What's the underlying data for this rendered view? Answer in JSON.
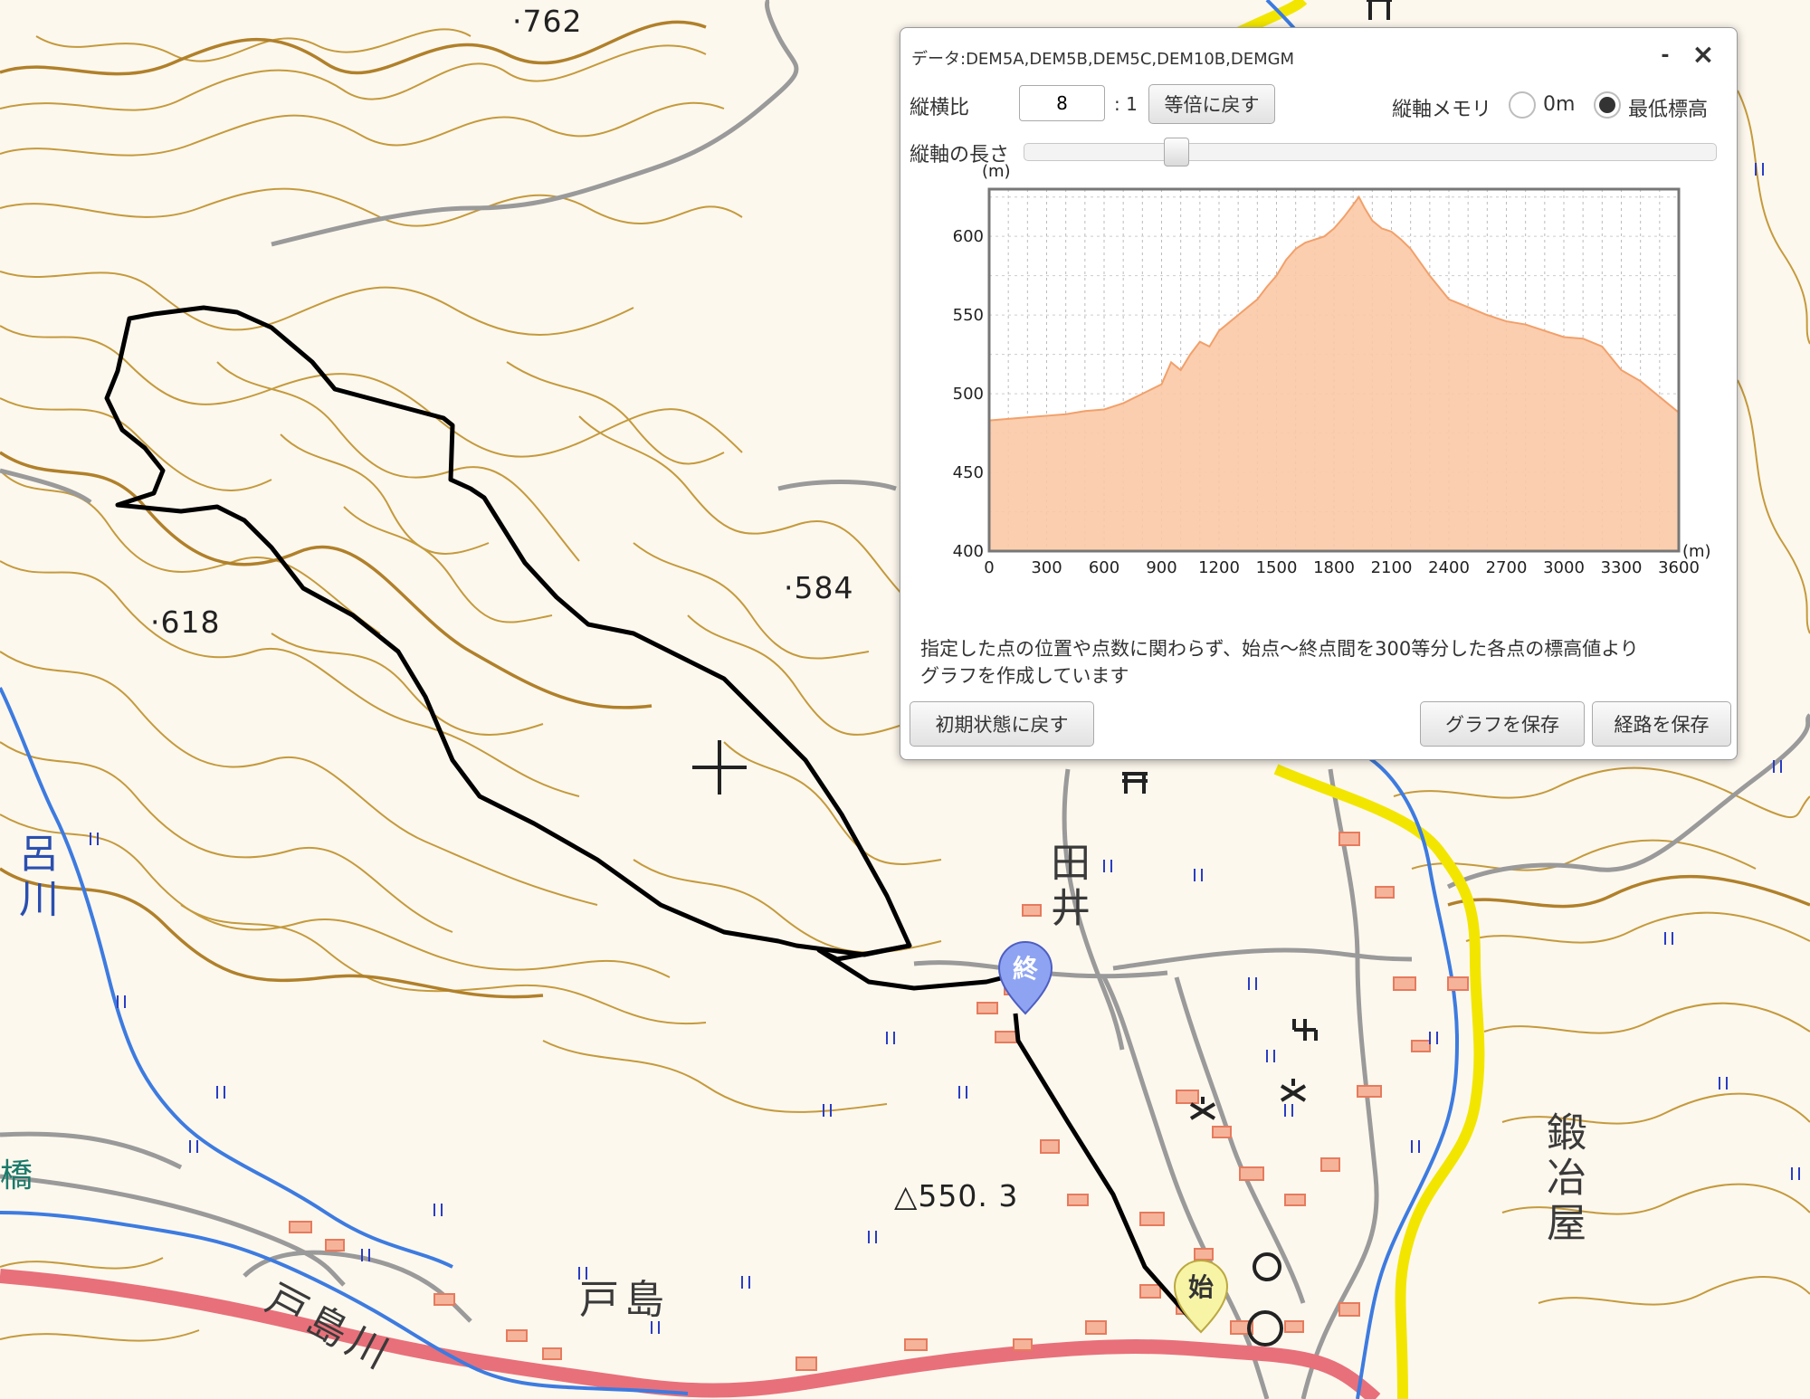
{
  "map": {
    "spot_heights": [
      {
        "key": "s762",
        "label": "762"
      },
      {
        "key": "s618",
        "label": "618"
      },
      {
        "key": "s584",
        "label": "584"
      },
      {
        "key": "s550",
        "label": "550. 3"
      }
    ],
    "place_names": [
      {
        "key": "tai",
        "label": "田井"
      },
      {
        "key": "toshima",
        "label": "戸島"
      },
      {
        "key": "toshimagawa",
        "label": "戸島川"
      },
      {
        "key": "kajiya",
        "label": "鍛冶屋"
      },
      {
        "key": "yorogawa",
        "label": "呂川"
      },
      {
        "key": "hashi",
        "label": "橋"
      }
    ],
    "markers": {
      "start": "始",
      "end": "終"
    },
    "colors": {
      "contour": "#c49a3c",
      "road": "#9a9a9a",
      "national_road": "#e8707a",
      "prefectural_road": "#f2e600",
      "river": "#3d7be0",
      "route": "#000000"
    }
  },
  "panel": {
    "title": "データ:DEM5A,DEM5B,DEM5C,DEM10B,DEMGM",
    "minimize_label": "-",
    "close_label": "×",
    "ratio_label": "縦横比",
    "ratio_value": "8",
    "ratio_suffix": ": 1",
    "reset_scale_button": "等倍に戻す",
    "axis_memory_label": "縦軸メモリ",
    "radio_0m_label": "0m",
    "radio_min_label": "最低標高",
    "axis_length_label": "縦軸の長さ",
    "slider_value": 0.21,
    "note_line1": "指定した点の位置や点数に関わらず、始点～終点間を300等分した各点の標高値より",
    "note_line2": "グラフを作成しています",
    "reset_button": "初期状態に戻す",
    "save_graph_button": "グラフを保存",
    "save_route_button": "経路を保存"
  },
  "chart_data": {
    "type": "area",
    "ylabel": "(m)",
    "xlabel": "(m)",
    "xlim": [
      0,
      3600
    ],
    "ylim": [
      400,
      630
    ],
    "xticks": [
      0,
      300,
      600,
      900,
      1200,
      1500,
      1800,
      2100,
      2400,
      2700,
      3000,
      3300,
      3600
    ],
    "yticks": [
      400,
      450,
      500,
      550,
      600
    ],
    "fill_color": "#f9c9a6",
    "line_color": "#f2a06a",
    "grid": true,
    "x": [
      0,
      100,
      200,
      300,
      400,
      500,
      600,
      700,
      800,
      850,
      900,
      950,
      1000,
      1050,
      1100,
      1150,
      1200,
      1250,
      1300,
      1350,
      1400,
      1450,
      1500,
      1550,
      1600,
      1650,
      1700,
      1750,
      1800,
      1850,
      1900,
      1930,
      1960,
      2000,
      2050,
      2100,
      2150,
      2200,
      2300,
      2400,
      2500,
      2600,
      2700,
      2800,
      2900,
      3000,
      3100,
      3200,
      3300,
      3400,
      3500,
      3600
    ],
    "y": [
      483,
      484,
      485,
      486,
      487,
      489,
      490,
      494,
      500,
      503,
      506,
      520,
      515,
      525,
      533,
      530,
      540,
      545,
      550,
      555,
      560,
      568,
      575,
      585,
      592,
      596,
      598,
      600,
      605,
      612,
      620,
      625,
      618,
      610,
      605,
      603,
      598,
      592,
      575,
      560,
      555,
      550,
      546,
      544,
      540,
      536,
      535,
      530,
      515,
      508,
      498,
      488
    ]
  }
}
